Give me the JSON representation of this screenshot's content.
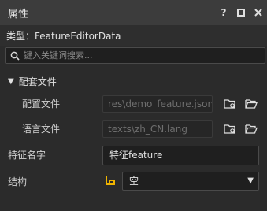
{
  "panel": {
    "title": "属性",
    "help_label": "?",
    "float_label": "□",
    "close_label": "✕"
  },
  "type_line": "类型：FeatureEditorData",
  "search": {
    "placeholder": "键入关键词搜索..."
  },
  "section": {
    "label": "配套文件",
    "expanded": true
  },
  "config_file": {
    "label": "配置文件",
    "value": "res\\demo_feature.json"
  },
  "lang_file": {
    "label": "语言文件",
    "value": "texts\\zh_CN.lang"
  },
  "feature_name": {
    "label": "特征名字",
    "value": "特征feature"
  },
  "structure": {
    "label": "结构",
    "value": "空"
  },
  "colors": {
    "accent": "#f0b400",
    "bg": "#2b2b2b",
    "titlebar": "#3c3c3c"
  }
}
